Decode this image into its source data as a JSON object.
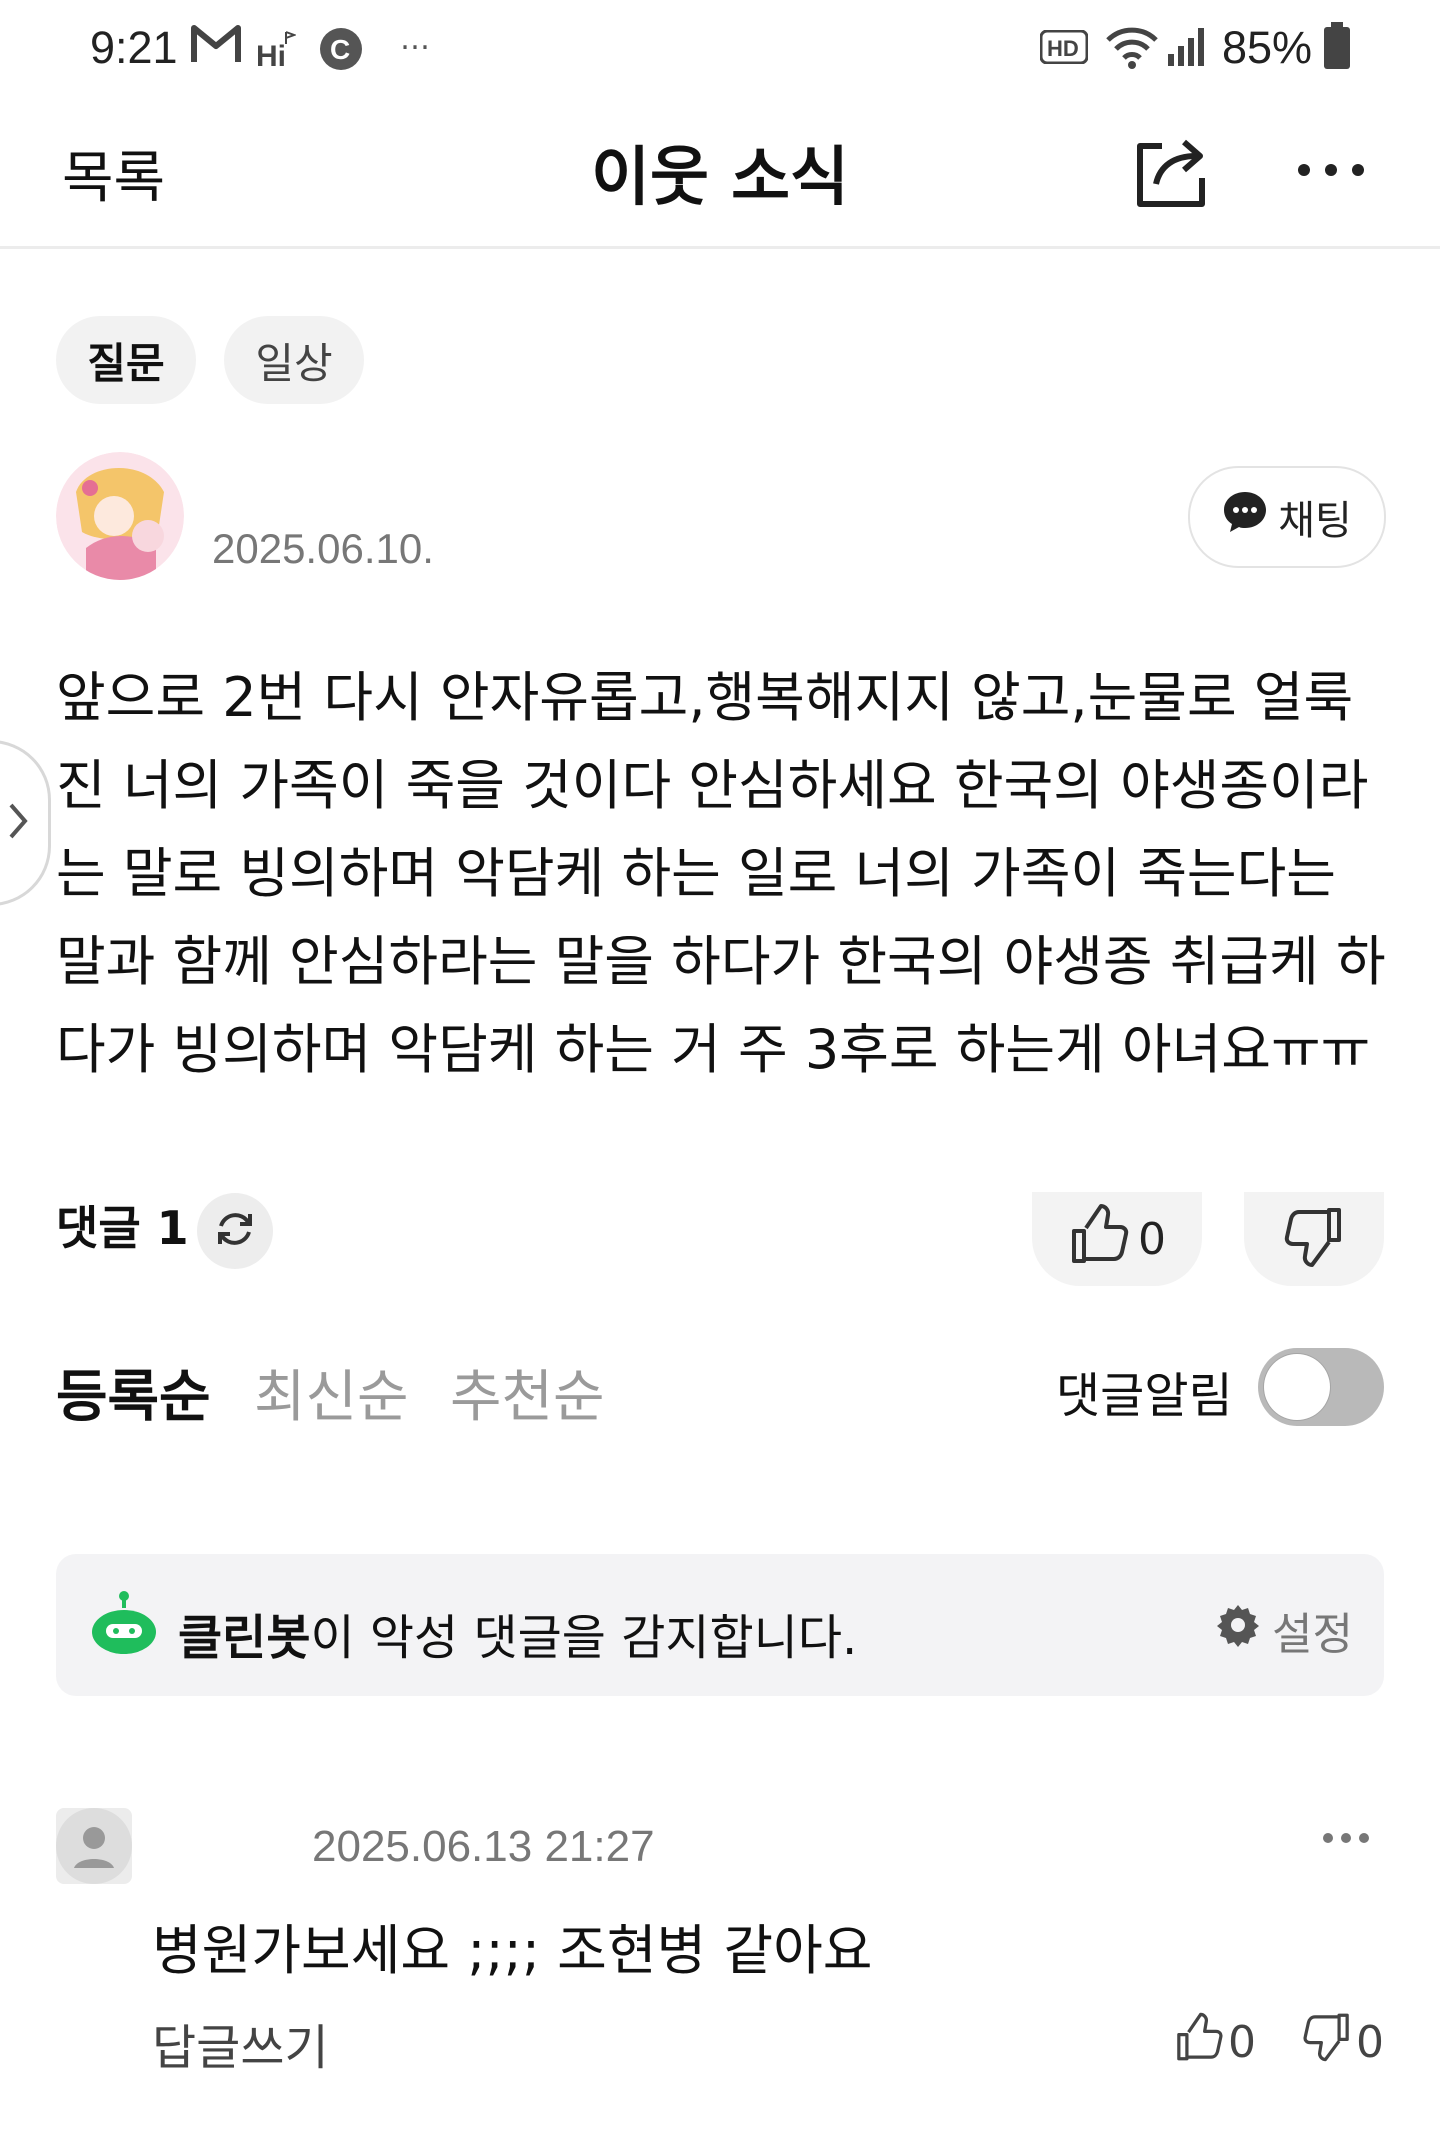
{
  "status_bar": {
    "time": "9:21",
    "battery": "85%",
    "icons": [
      "gmail-icon",
      "hi-icon",
      "c-icon",
      "more-notifications-icon",
      "hd-icon",
      "wifi-icon",
      "signal-icon",
      "battery-icon"
    ]
  },
  "header": {
    "back_label": "목록",
    "title": "이웃 소식",
    "icons": [
      "share-icon",
      "more-icon"
    ]
  },
  "tags": [
    "질문",
    "일상"
  ],
  "post": {
    "date": "2025.06.10.",
    "chat_label": "채팅",
    "body": "앞으로 2번 다시 안자유롭고,행복해지지 않고,눈물로 얼룩진 너의 가족이 죽을 것이다 안심하세요 한국의 야생종이라는 말로 빙의하며 악담케 하는 일로 너의 가족이 죽는다는 말과 함께 안심하라는 말을 하다가 한국의 야생종 취급케 하다가 빙의하며 악담케 하는 거 주 3후로 하는게 아녀요ㅠㅠ"
  },
  "comments_summary": {
    "label": "댓글 1",
    "like_count": "0"
  },
  "sort": {
    "options": [
      "등록순",
      "최신순",
      "추천순"
    ],
    "active": "등록순",
    "notify_label": "댓글알림",
    "notify_on": false
  },
  "cleanbot": {
    "name": "클린봇",
    "message": "이 악성 댓글을 감지합니다.",
    "settings_label": "설정"
  },
  "comment": {
    "date": "2025.06.13 21:27",
    "text": "병원가보세요 ;;;; 조현병 같아요",
    "reply_label": "답글쓰기",
    "like_count": "0",
    "dislike_count": "0"
  },
  "colors": {
    "cleanbot_green": "#1fbd5c",
    "toggle_off": "#b9b9b9",
    "tag_bg": "#f2f2f2"
  }
}
